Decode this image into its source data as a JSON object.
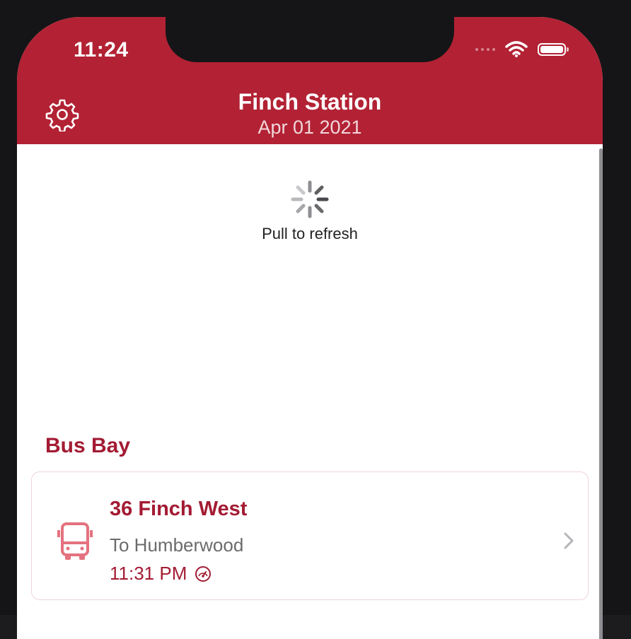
{
  "status_bar": {
    "time": "11:24"
  },
  "header": {
    "title": "Finch Station",
    "subtitle": "Apr 01 2021",
    "background_color": "#b22234",
    "settings_icon": "gear-icon"
  },
  "refresh": {
    "label": "Pull to refresh",
    "icon": "activity-spinner-icon"
  },
  "section": {
    "title": "Bus Bay"
  },
  "departure": {
    "route": "36 Finch West",
    "destination": "To Humberwood",
    "time": "11:31 PM",
    "icon": "bus-icon",
    "status_icon": "gauge-icon",
    "accent_color": "#a31b33"
  }
}
